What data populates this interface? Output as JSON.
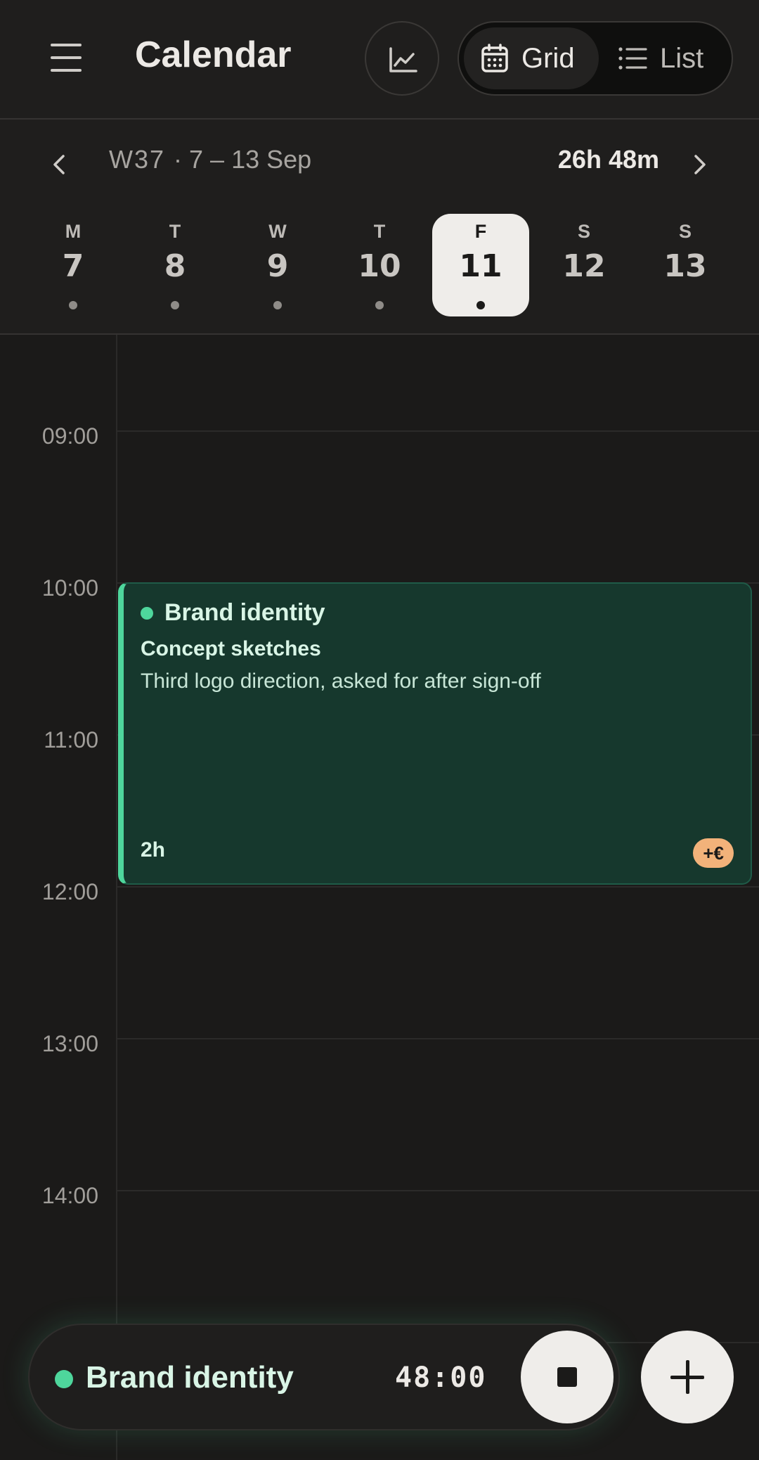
{
  "header": {
    "title": "Calendar",
    "view_toggle": [
      {
        "label": "Grid",
        "icon": "calendar-icon",
        "active": true
      },
      {
        "label": "List",
        "icon": "list-icon",
        "active": false
      }
    ],
    "stats_icon": "chart-line-icon",
    "menu_icon": "hamburger-icon"
  },
  "week": {
    "label": "W37",
    "range": "· 7 – 13 Sep",
    "total": "26h 48m",
    "days": [
      {
        "dow": "M",
        "num": "7",
        "has_dot": true
      },
      {
        "dow": "T",
        "num": "8",
        "has_dot": true
      },
      {
        "dow": "W",
        "num": "9",
        "has_dot": true
      },
      {
        "dow": "T",
        "num": "10",
        "has_dot": true
      },
      {
        "dow": "F",
        "num": "11",
        "has_dot": true,
        "selected": true
      },
      {
        "dow": "S",
        "num": "12",
        "has_dot": false
      },
      {
        "dow": "S",
        "num": "13",
        "has_dot": false
      }
    ]
  },
  "timeline": {
    "hours": [
      "09:00",
      "10:00",
      "11:00",
      "12:00",
      "13:00",
      "14:00"
    ]
  },
  "event": {
    "project": "Brand identity",
    "title": "Concept sketches",
    "description": "Third logo direction, asked for after sign-off",
    "duration": "2h",
    "badge": "+€",
    "accent_color": "#4ed69c"
  },
  "timer": {
    "project": "Brand identity",
    "elapsed": "48:00"
  }
}
